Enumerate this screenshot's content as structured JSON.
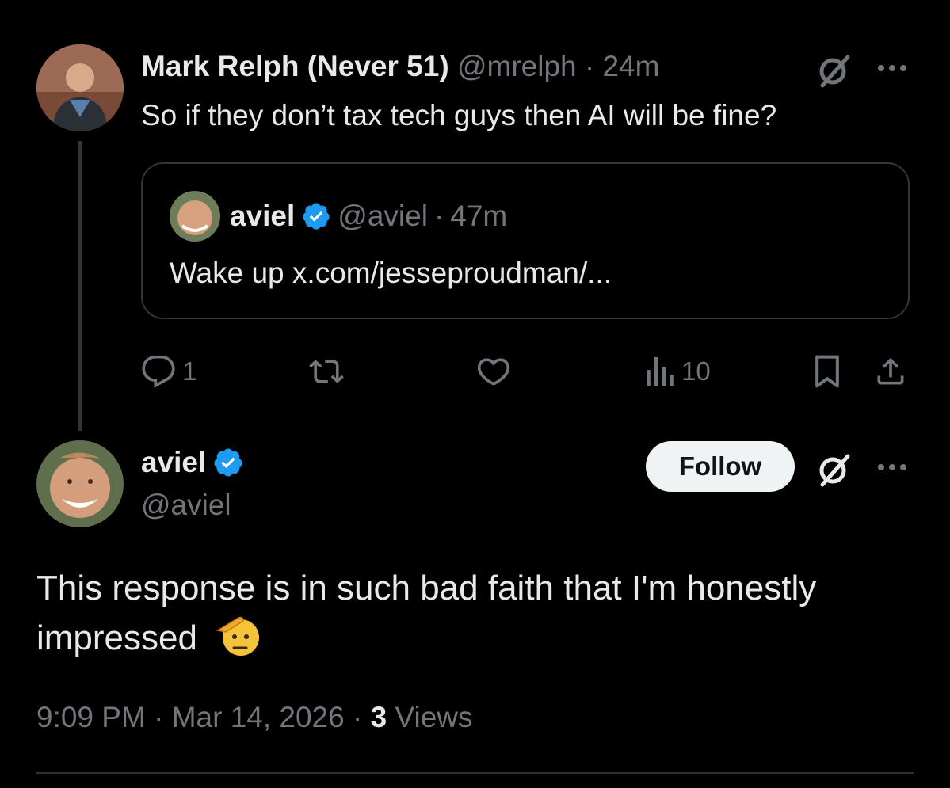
{
  "parent": {
    "display_name": "Mark Relph (Never 51)",
    "handle": "@mrelph",
    "separator": "·",
    "time": "24m",
    "text": "So if they don’t tax tech guys then AI will be fine?",
    "quote": {
      "display_name": "aviel",
      "handle": "@aviel",
      "separator": "·",
      "time": "47m",
      "text": "Wake up x.com/jesseproudman/..."
    },
    "actions": {
      "reply_count": "1",
      "views_count": "10"
    }
  },
  "main": {
    "display_name": "aviel",
    "handle": "@aviel",
    "follow_label": "Follow",
    "text": "This response is in such bad faith that I'm honestly impressed",
    "emoji_icon": "saluting-face",
    "time": "9:09 PM",
    "separator": "·",
    "date": "Mar 14, 2026",
    "views_count": "3",
    "views_label": "Views"
  },
  "colors": {
    "background": "#000000",
    "text": "#e7e9ea",
    "muted": "#71767b",
    "verified": "#1d9bf0",
    "border": "#2f3336"
  }
}
